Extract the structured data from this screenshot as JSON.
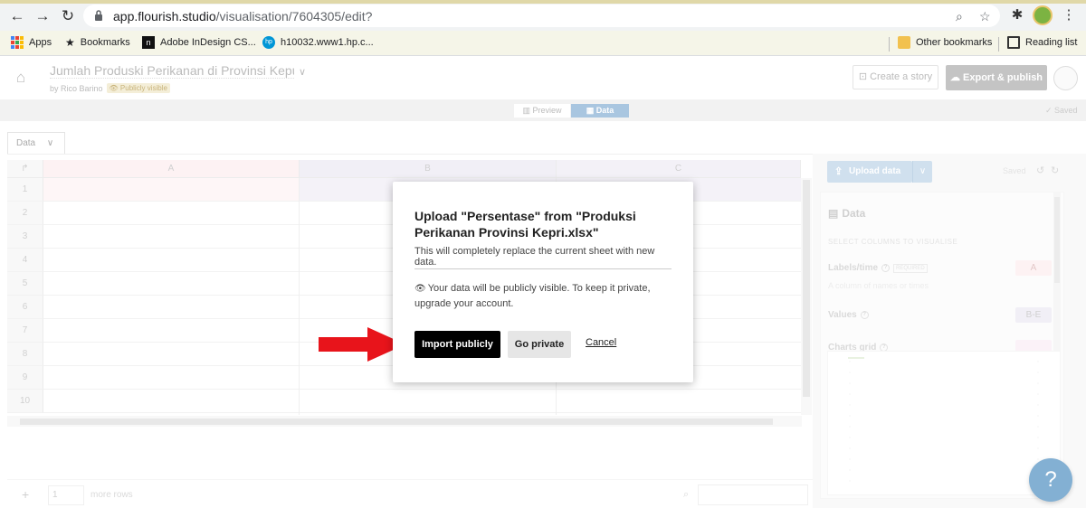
{
  "browser": {
    "url_host": "app.flourish.studio",
    "url_path": "/visualisation/7604305/edit?",
    "bookmarks": [
      "Apps",
      "Bookmarks",
      "Adobe InDesign CS...",
      "h10032.www1.hp.c..."
    ],
    "bookmarks_right": [
      "Other bookmarks",
      "Reading list"
    ]
  },
  "header": {
    "title": "Jumlah Produski Perikanan di Provinsi Kepul",
    "byline": "by Rico Barino",
    "badge": "Publicly visible",
    "create_story": "Create a story",
    "export_publish": "Export & publish"
  },
  "modes": {
    "preview": "Preview",
    "data": "Data",
    "saved": "Saved"
  },
  "sheet": {
    "tab": "Data",
    "columns": [
      "A",
      "B",
      "C"
    ],
    "rows": [
      "1",
      "2",
      "3",
      "4",
      "5",
      "6",
      "7",
      "8",
      "9",
      "10"
    ],
    "rows_to_add": "1",
    "more_rows": "more rows"
  },
  "panel": {
    "upload": "Upload data",
    "saved": "Saved",
    "heading": "Data",
    "subheading": "SELECT COLUMNS TO VISUALISE",
    "labels_label": "Labels/time",
    "required": "REQUIRED",
    "labels_desc": "A column of names or times",
    "labels_value": "A",
    "values_label": "Values",
    "values_value": "B-E",
    "grid_label": "Charts grid"
  },
  "modal": {
    "title": "Upload \"Persentase\" from \"Produksi Perikanan Provinsi Kepri.xlsx\"",
    "desc": "This will completely replace the current sheet with new data.",
    "note": "Your data will be publicly visible. To keep it private, upgrade your account.",
    "import": "Import publicly",
    "private": "Go private",
    "cancel": "Cancel"
  },
  "help": "?",
  "colors": {
    "accent": "#a9c6e0",
    "help": "#1e6fb0",
    "arrow": "#e8141b"
  }
}
